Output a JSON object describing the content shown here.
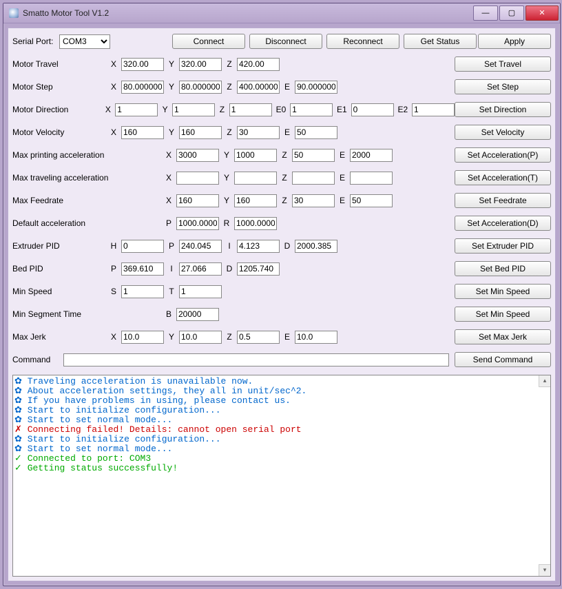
{
  "window": {
    "title": "Smatto Motor Tool V1.2"
  },
  "top": {
    "serial_label": "Serial Port:",
    "port": "COM3",
    "connect": "Connect",
    "disconnect": "Disconnect",
    "reconnect": "Reconnect",
    "get_status": "Get Status",
    "apply": "Apply"
  },
  "rows": {
    "travel": {
      "label": "Motor Travel",
      "X": "320.00",
      "Y": "320.00",
      "Z": "420.00",
      "btn": "Set Travel"
    },
    "step": {
      "label": "Motor Step",
      "X": "80.000000",
      "Y": "80.000000",
      "Z": "400.00000",
      "E": "90.000000",
      "btn": "Set Step"
    },
    "dir": {
      "label": "Motor Direction",
      "X": "1",
      "Y": "1",
      "Z": "1",
      "E0": "1",
      "E1": "0",
      "E2": "1",
      "btn": "Set Direction"
    },
    "vel": {
      "label": "Motor Velocity",
      "X": "160",
      "Y": "160",
      "Z": "30",
      "E": "50",
      "btn": "Set Velocity"
    },
    "accP": {
      "label": "Max printing acceleration",
      "X": "3000",
      "Y": "1000",
      "Z": "50",
      "E": "2000",
      "btn": "Set Acceleration(P)"
    },
    "accT": {
      "label": "Max traveling acceleration",
      "X": "",
      "Y": "",
      "Z": "",
      "E": "",
      "btn": "Set Acceleration(T)"
    },
    "feed": {
      "label": "Max Feedrate",
      "X": "160",
      "Y": "160",
      "Z": "30",
      "E": "50",
      "btn": "Set Feedrate"
    },
    "accD": {
      "label": "Default acceleration",
      "P": "1000.0000",
      "R": "1000.0000",
      "btn": "Set Acceleration(D)"
    },
    "epid": {
      "label": "Extruder PID",
      "H": "0",
      "P": "240.045",
      "I": "4.123",
      "D": "2000.385",
      "btn": "Set Extruder PID"
    },
    "bpid": {
      "label": "Bed PID",
      "P": "369.610",
      "I": "27.066",
      "D": "1205.740",
      "btn": "Set Bed PID"
    },
    "mspd": {
      "label": "Min Speed",
      "S": "1",
      "T": "1",
      "btn": "Set Min Speed"
    },
    "mseg": {
      "label": "Min Segment Time",
      "B": "20000",
      "btn": "Set Min Speed"
    },
    "jerk": {
      "label": "Max Jerk",
      "X": "10.0",
      "Y": "10.0",
      "Z": "0.5",
      "E": "10.0",
      "btn": "Set Max Jerk"
    },
    "cmd": {
      "label": "Command",
      "val": "",
      "btn": "Send Command"
    }
  },
  "tags": {
    "X": "X",
    "Y": "Y",
    "Z": "Z",
    "E": "E",
    "E0": "E0",
    "E1": "E1",
    "E2": "E2",
    "H": "H",
    "P": "P",
    "I": "I",
    "D": "D",
    "S": "S",
    "T": "T",
    "B": "B",
    "R": "R"
  },
  "log": [
    {
      "t": "i",
      "s": "✿ Traveling acceleration is unavailable now."
    },
    {
      "t": "i",
      "s": "✿ About acceleration settings, they all in unit/sec^2."
    },
    {
      "t": "i",
      "s": "✿ If you have problems in using, please contact us."
    },
    {
      "t": "i",
      "s": "✿ Start to initialize configuration..."
    },
    {
      "t": "i",
      "s": "✿ Start to set normal mode..."
    },
    {
      "t": "e",
      "s": "✗ Connecting failed! Details: cannot open serial port"
    },
    {
      "t": "i",
      "s": "✿ Start to initialize configuration..."
    },
    {
      "t": "i",
      "s": "✿ Start to set normal mode..."
    },
    {
      "t": "o",
      "s": "✓ Connected to port: COM3"
    },
    {
      "t": "o",
      "s": "✓ Getting status successfully!"
    }
  ]
}
